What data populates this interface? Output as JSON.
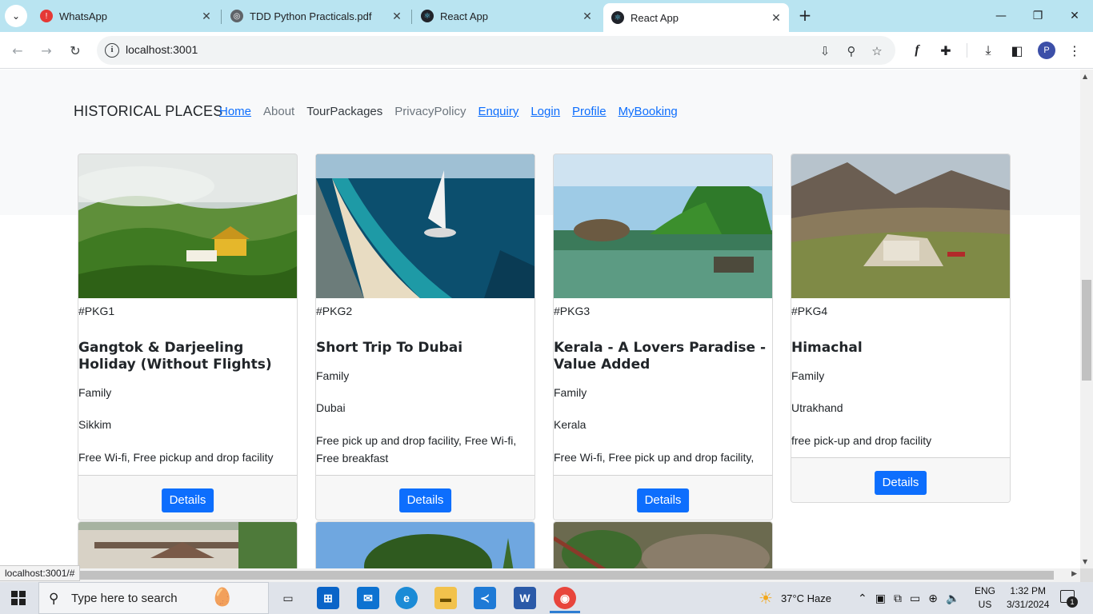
{
  "browser": {
    "tabs": [
      {
        "title": "WhatsApp",
        "icon": "alert-icon"
      },
      {
        "title": "TDD Python Practicals.pdf",
        "icon": "globe-icon"
      },
      {
        "title": "React App",
        "icon": "react-icon"
      },
      {
        "title": "React App",
        "icon": "react-icon",
        "active": true
      }
    ],
    "url": "localhost:3001",
    "profile_initial": "P",
    "status_url": "localhost:3001/#"
  },
  "site": {
    "brand": "HISTORICAL PLACES",
    "nav": [
      "Home",
      "About",
      "TourPackages",
      "PrivacyPolicy",
      "Enquiry",
      "Login",
      "Profile",
      "MyBooking"
    ]
  },
  "cards": [
    {
      "pkg": "#PKG1",
      "title": "Gangtok & Darjeeling Holiday (Without Flights)",
      "type": "Family",
      "place": "Sikkim",
      "facilities": "Free Wi-fi, Free pickup and drop facility",
      "button": "Details"
    },
    {
      "pkg": "#PKG2",
      "title": "Short Trip To Dubai",
      "type": "Family",
      "place": "Dubai",
      "facilities": "Free pick up and drop facility, Free Wi-fi, Free breakfast",
      "button": "Details"
    },
    {
      "pkg": "#PKG3",
      "title": "Kerala - A Lovers Paradise - Value Added",
      "type": "Family",
      "place": "Kerala",
      "facilities": "Free Wi-fi, Free pick up and drop facility,",
      "button": "Details"
    },
    {
      "pkg": "#PKG4",
      "title": "Himachal",
      "type": "Family",
      "place": "Utrakhand",
      "facilities": "free pick-up and drop facility",
      "button": "Details"
    }
  ],
  "taskbar": {
    "search_placeholder": "Type here to search",
    "weather": "37°C  Haze",
    "lang_1": "ENG",
    "lang_2": "US",
    "time": "1:32 PM",
    "date": "3/31/2024",
    "notifications": "1"
  },
  "colors": {
    "tabstrip": "#b9e4f1",
    "link": "#0d6efd",
    "button": "#0d6efd"
  }
}
